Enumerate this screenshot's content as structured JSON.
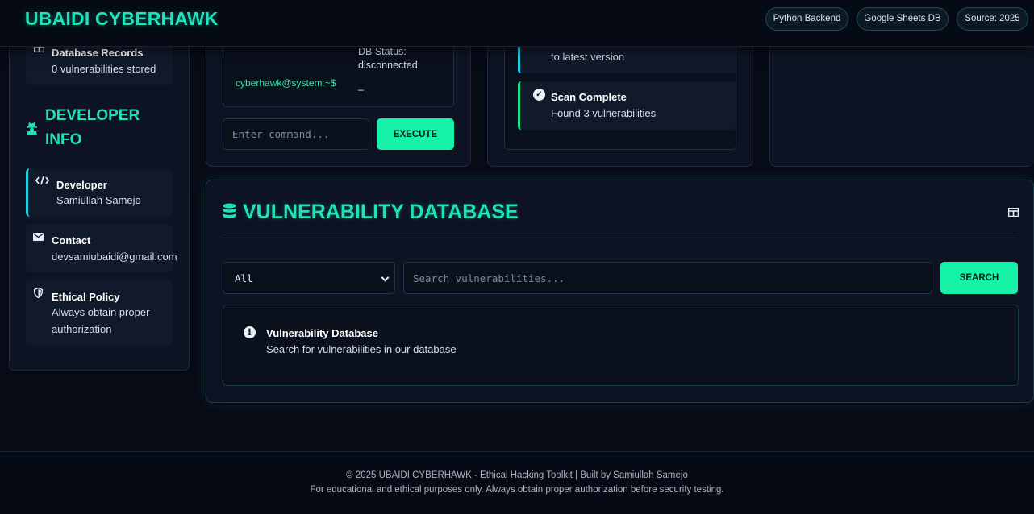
{
  "header": {
    "brand": "UBAIDI CYBERHAWK",
    "badges": [
      "Python Backend",
      "Google Sheets DB",
      "Source: 2025"
    ]
  },
  "sidebar": {
    "db_records": {
      "title": "Database Records",
      "text": "0 vulnerabilities stored",
      "icon": "table-icon"
    },
    "developer_heading": "DEVELOPER INFO",
    "developer": {
      "title": "Developer",
      "text": "Samiullah Samejo",
      "icon": "code-icon"
    },
    "contact": {
      "title": "Contact",
      "text": "devsamiubaidi@gmail.com",
      "icon": "envelope-icon"
    },
    "policy": {
      "title": "Ethical Policy",
      "text": "Always obtain proper authorization",
      "icon": "shield-icon"
    }
  },
  "terminal": {
    "prompt": "cyberhawk@system:~$",
    "status": "DB Status: disconnected",
    "cursor": "_",
    "input_placeholder": "Enter command...",
    "execute_label": "EXECUTE"
  },
  "activity": {
    "items": [
      {
        "title": "",
        "text": "to latest version"
      },
      {
        "title": "Scan Complete",
        "text": "Found 3 vulnerabilities"
      }
    ]
  },
  "vuln_db": {
    "title": "VULNERABILITY DATABASE",
    "filter_selected": "All",
    "search_placeholder": "Search vulnerabilities...",
    "search_label": "SEARCH",
    "result_title": "Vulnerability Database",
    "result_text": "Search for vulnerabilities in our database"
  },
  "footer": {
    "line1": "© 2025 UBAIDI CYBERHAWK - Ethical Hacking Toolkit | Built by Samiullah Samejo",
    "line2": "For educational and ethical purposes only. Always obtain proper authorization before security testing."
  },
  "colors": {
    "accent": "#1fe3b8",
    "button": "#16f2a7",
    "background": "#070b16"
  }
}
